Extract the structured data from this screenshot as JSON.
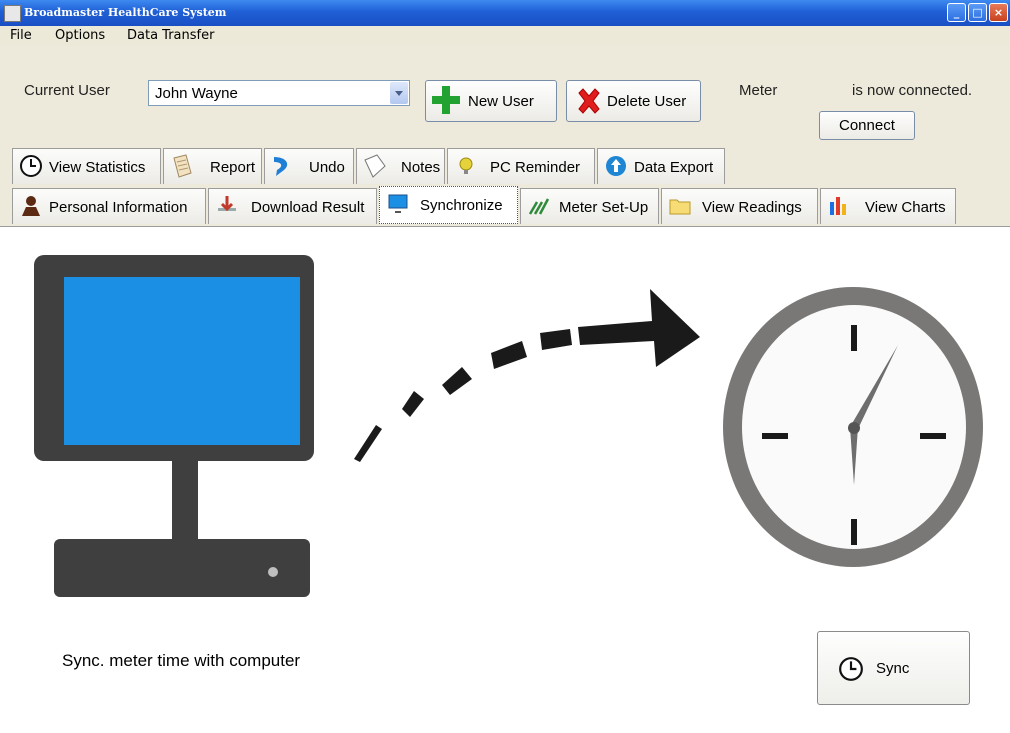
{
  "window": {
    "title": "Broadmaster HealthCare System"
  },
  "menu": {
    "items": [
      "File",
      "Options",
      "Data Transfer"
    ]
  },
  "user": {
    "label": "Current User",
    "selected": "John Wayne",
    "new_user": "New User",
    "delete_user": "Delete User"
  },
  "meter": {
    "label": "Meter",
    "status": "is now connected.",
    "connect": "Connect"
  },
  "tabs_row1": [
    "View Statistics",
    "Report",
    "Undo",
    "Notes",
    "PC Reminder",
    "Data Export"
  ],
  "tabs_row2": [
    "Personal Information",
    "Download Result",
    "Synchronize",
    "Meter Set-Up",
    "View Readings",
    "View Charts"
  ],
  "active_tab": "Synchronize",
  "sync": {
    "description": "Sync. meter time with computer",
    "button": "Sync"
  },
  "colors": {
    "screen_blue": "#1a8fe3",
    "monitor_dark": "#3f3f3f",
    "clock_ring": "#7a7876",
    "plus_green": "#22a331",
    "delete_red": "#e01d1d"
  },
  "icons": {
    "view-statistics": "clock-icon",
    "report": "document-icon",
    "undo": "undo-arrow-icon",
    "notes": "note-icon",
    "pc-reminder": "bulb-icon",
    "data-export": "globe-export-icon",
    "personal-information": "person-icon",
    "download-result": "download-icon",
    "synchronize": "monitor-sync-icon",
    "meter-set-up": "signal-icon",
    "view-readings": "folder-icon",
    "view-charts": "bar-chart-icon"
  }
}
